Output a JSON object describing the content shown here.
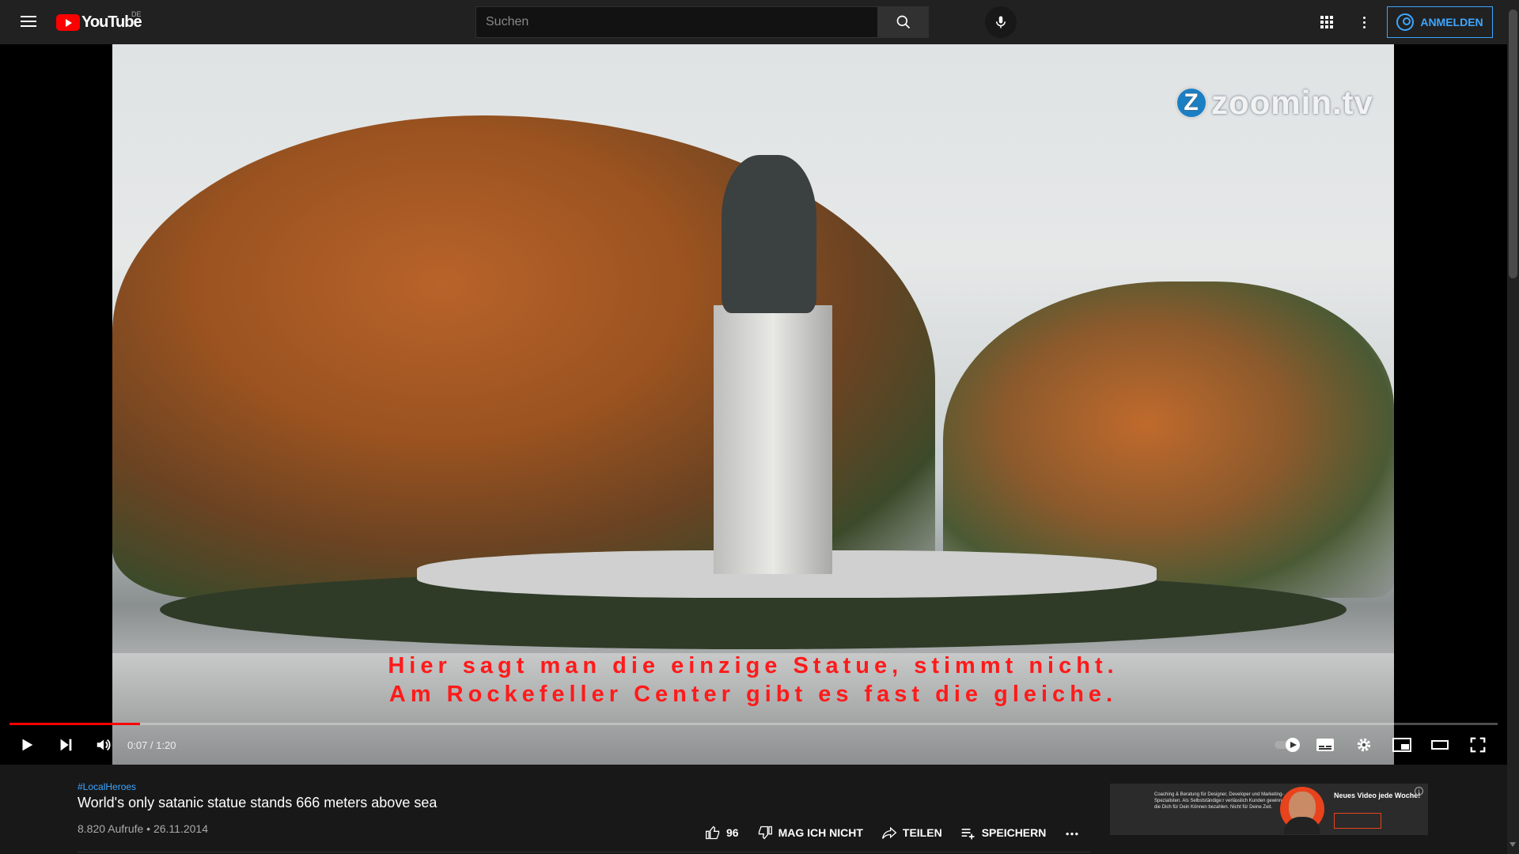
{
  "header": {
    "logo_text": "YouTube",
    "country_code": "DE",
    "search_placeholder": "Suchen",
    "signin_label": "ANMELDEN"
  },
  "player": {
    "watermark": "zoomin.tv",
    "watermark_badge": "Z",
    "subtitle_line1": "Hier sagt man die einzige Statue, stimmt nicht.",
    "subtitle_line2": "Am Rockefeller Center gibt es fast die gleiche.",
    "time_display": "0:07 / 1:20",
    "progress_fraction": 0.0875
  },
  "video_info": {
    "hashtag": "#LocalHeroes",
    "title": "World's only satanic statue stands 666 meters above sea",
    "meta": "8.820 Aufrufe • 26.11.2014",
    "like_count": "96",
    "dislike_label": "MAG ICH NICHT",
    "share_label": "TEILEN",
    "save_label": "SPEICHERN"
  },
  "ad": {
    "body_text": "Coaching & Beratung für Designer, Developer und Marketing-Spezialisten. Als Selbstständige:r verlässlich Kunden gewinnen, die Dich für Dein Können bezahlen. Nicht für Deine Zeit.",
    "headline": "Neues Video jede Woche!",
    "info_glyph": "i"
  },
  "colors": {
    "accent": "#3ea6ff",
    "brand_red": "#ff0000",
    "subtitle_red": "#ff1a1a",
    "background": "#181818",
    "header": "#212121"
  }
}
